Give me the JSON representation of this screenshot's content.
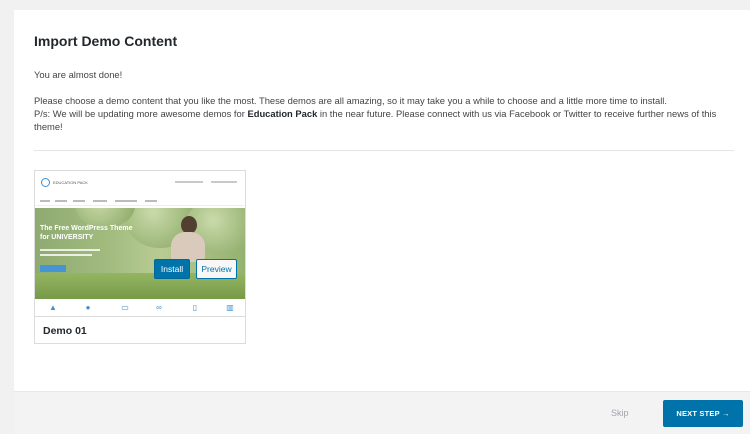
{
  "page": {
    "title": "Import Demo Content",
    "intro": "You are almost done!",
    "description_line1": "Please choose a demo content that you like the most. These demos are all amazing, so it may take you a while to choose and a little more time to install.",
    "description_line2_prefix": "P/s: We will be updating more awesome demos for ",
    "description_line2_bold": "Education Pack",
    "description_line2_suffix": " in the near future. Please connect with us via Facebook or Twitter to receive further news of this",
    "description_line3": "theme!"
  },
  "demos": [
    {
      "name": "Demo 01",
      "install_label": "Install",
      "preview_label": "Preview",
      "thumb": {
        "logo_text": "EDUCATION PACK",
        "hero_title_line1": "The Free WordPress Theme",
        "hero_title_line2": "for UNIVERSITY"
      }
    }
  ],
  "footer": {
    "skip_label": "Skip",
    "next_label": "NEXT STEP →"
  },
  "colors": {
    "accent": "#0073aa",
    "background": "#f1f1f1",
    "panel": "#ffffff"
  }
}
